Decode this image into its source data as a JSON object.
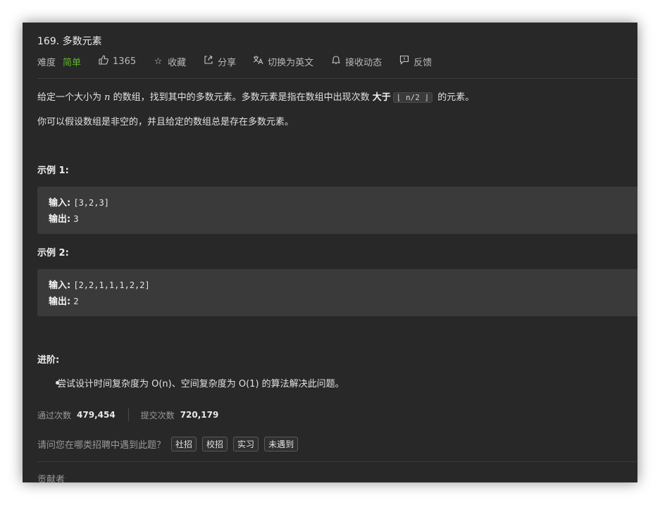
{
  "problem": {
    "title": "169. 多数元素",
    "difficulty_label": "难度",
    "difficulty": "简单",
    "likes": "1365",
    "actions": {
      "favorite": "收藏",
      "share": "分享",
      "switch_lang": "切换为英文",
      "subscribe": "接收动态",
      "feedback": "反馈"
    }
  },
  "description": {
    "p1_part1": "给定一个大小为 ",
    "p1_var": "n",
    "p1_part2": " 的数组，找到其中的多数元素。多数元素是指在数组中出现次数 ",
    "p1_bold": "大于",
    "p1_code": "⌊ n/2 ⌋",
    "p1_part3": " 的元素。",
    "p2": "你可以假设数组是非空的，并且给定的数组总是存在多数元素。"
  },
  "examples": [
    {
      "heading": "示例 1:",
      "input_label": "输入:",
      "input": "[3,2,3]",
      "output_label": "输出:",
      "output": "3"
    },
    {
      "heading": "示例 2:",
      "input_label": "输入:",
      "input": "[2,2,1,1,1,2,2]",
      "output_label": "输出:",
      "output": "2"
    }
  ],
  "advanced": {
    "heading": "进阶:",
    "item": "尝试设计时间复杂度为 O(n)、空间复杂度为 O(1) 的算法解决此问题。"
  },
  "stats": {
    "accepted_label": "通过次数",
    "accepted": "479,454",
    "submitted_label": "提交次数",
    "submitted": "720,179"
  },
  "survey": {
    "question": "请问您在哪类招聘中遇到此题？",
    "options": [
      "社招",
      "校招",
      "实习",
      "未遇到"
    ]
  },
  "contributors_label": "贡献者"
}
